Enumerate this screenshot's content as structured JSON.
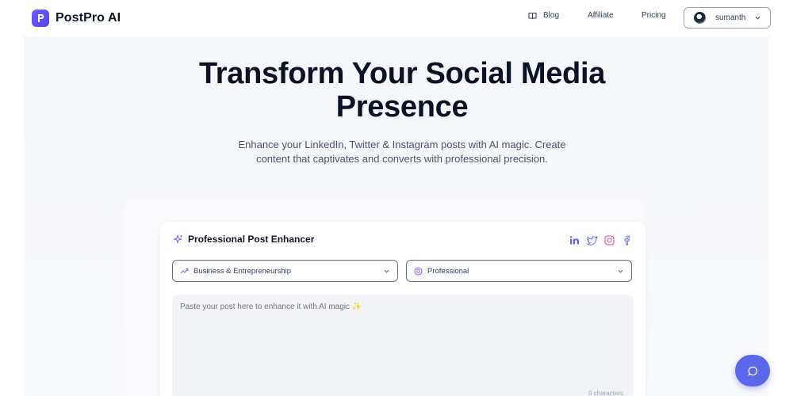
{
  "brand": {
    "name": "PostPro AI",
    "logo_letter": "P"
  },
  "nav": {
    "blog": "Blog",
    "affiliate": "Affiliate",
    "pricing": "Pricing"
  },
  "user": {
    "name": "sumanth"
  },
  "hero": {
    "title_line1": "Transform Your Social Media",
    "title_line2": "Presence",
    "subtitle_line1": "Enhance your LinkedIn, Twitter & Instagram posts with AI magic. Create",
    "subtitle_line2": "content that captivates and converts with professional precision."
  },
  "card": {
    "title": "Professional Post Enhancer",
    "social_icons": [
      "linkedin-icon",
      "twitter-icon",
      "instagram-icon",
      "facebook-icon"
    ],
    "category_select": {
      "value": "Business & Entrepreneurship"
    },
    "tone_select": {
      "value": "Professional"
    },
    "post_input": {
      "placeholder": "Paste your post here to enhance it with AI magic ✨",
      "value": ""
    },
    "char_count": "0 characters"
  },
  "colors": {
    "accent": "#5a67e8",
    "brand": "#4f46e5",
    "social": "#6366f1",
    "instagram": "#ec4899"
  }
}
